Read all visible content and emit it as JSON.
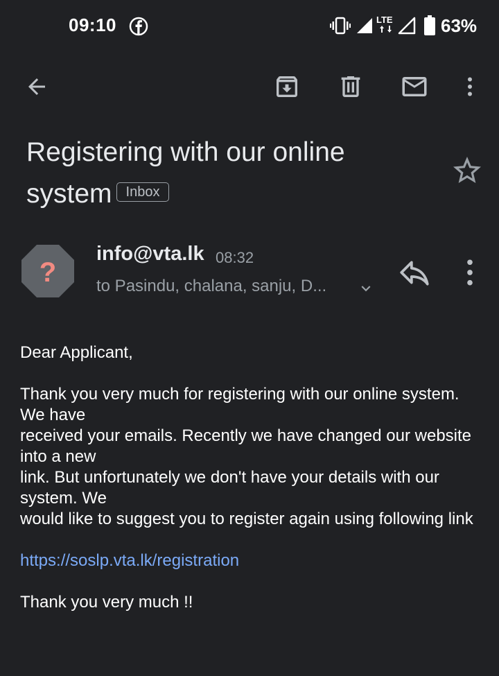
{
  "status_bar": {
    "time": "09:10",
    "network": "LTE",
    "battery": "63%",
    "icons": [
      "facebook-icon",
      "vibrate-icon",
      "signal-icon",
      "battery-icon"
    ]
  },
  "toolbar": {
    "icons": [
      "back-arrow-icon",
      "archive-icon",
      "delete-icon",
      "mail-icon",
      "more-vert-icon"
    ]
  },
  "email": {
    "subject": "Registering with our online system",
    "label": "Inbox",
    "sender": "info@vta.lk",
    "time": "08:32",
    "recipients": "to Pasindu, chalana, sanju, D...",
    "body": {
      "greeting": "Dear Applicant,",
      "lines": [
        "Thank you very much for registering with our online system. We have",
        "received your emails. Recently we have changed our website into a new",
        "link. But unfortunately we don't have your details with our system. We",
        "would like to suggest you to register again using following link"
      ],
      "link": "https://soslp.vta.lk/registration",
      "closing": "Thank you very much !!"
    }
  },
  "colors": {
    "background": "#202124",
    "text": "#e8eaed",
    "secondary_text": "#9aa0a6",
    "link": "#7baaf7",
    "avatar_bg": "#5f6368",
    "avatar_mark": "#f28b82"
  }
}
